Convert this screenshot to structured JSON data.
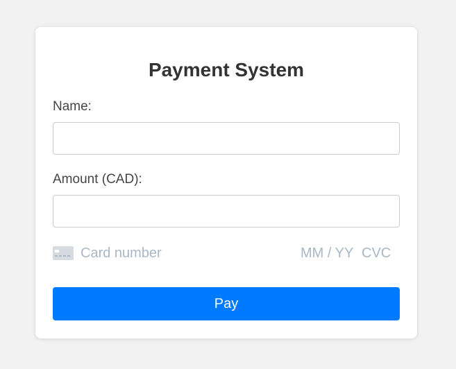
{
  "form": {
    "title": "Payment System",
    "name_label": "Name:",
    "name_value": "",
    "amount_label": "Amount (CAD):",
    "amount_value": ""
  },
  "card_element": {
    "icon": "credit-card-icon",
    "number_placeholder": "Card number",
    "expiry_placeholder": "MM / YY",
    "cvc_placeholder": "CVC"
  },
  "pay_button": {
    "label": "Pay"
  },
  "colors": {
    "background": "#f2f2f2",
    "card": "#ffffff",
    "accent": "#007bff",
    "placeholder": "#aab7c4",
    "title": "#333333"
  }
}
